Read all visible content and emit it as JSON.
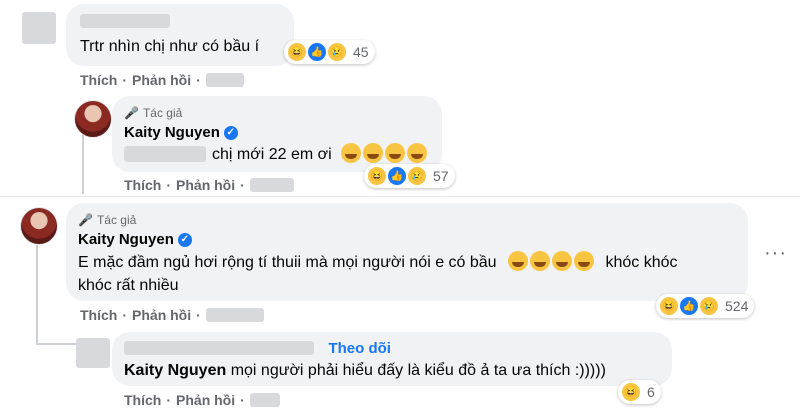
{
  "comment1": {
    "text": "Trtr nhìn chị như có bầu í",
    "reaction_count": "45",
    "like": "Thích",
    "reply": "Phản hồi"
  },
  "reply1": {
    "author_tag": "Tác giả",
    "author": "Kaity Nguyen",
    "text": "chị mới 22 em ơi",
    "reaction_count": "57",
    "like": "Thích",
    "reply": "Phản hồi"
  },
  "comment2": {
    "author_tag": "Tác giả",
    "author": "Kaity Nguyen",
    "text_line1": "E mặc đầm ngủ hơi rộng tí thuii mà mọi người nói e có bầu",
    "text_after_emoji": "khóc khóc",
    "text_line2": "khóc rất nhiều",
    "reaction_count": "524",
    "like": "Thích",
    "reply": "Phản hồi"
  },
  "reply2": {
    "follow": "Theo dõi",
    "mention": "Kaity Nguyen",
    "text": "mọi người phải hiểu đấy là kiểu đồ ả ta ưa thích :)))))",
    "reaction_count": "6",
    "like": "Thích",
    "reply": "Phản hồi"
  },
  "icons": [
    "haha-icon",
    "like-icon",
    "sad-icon",
    "cry-emoji",
    "verified-icon",
    "mic-icon",
    "more-options-icon"
  ],
  "colors": {
    "bubble": "#f0f2f5",
    "link": "#1877f2",
    "meta": "#65676b"
  }
}
